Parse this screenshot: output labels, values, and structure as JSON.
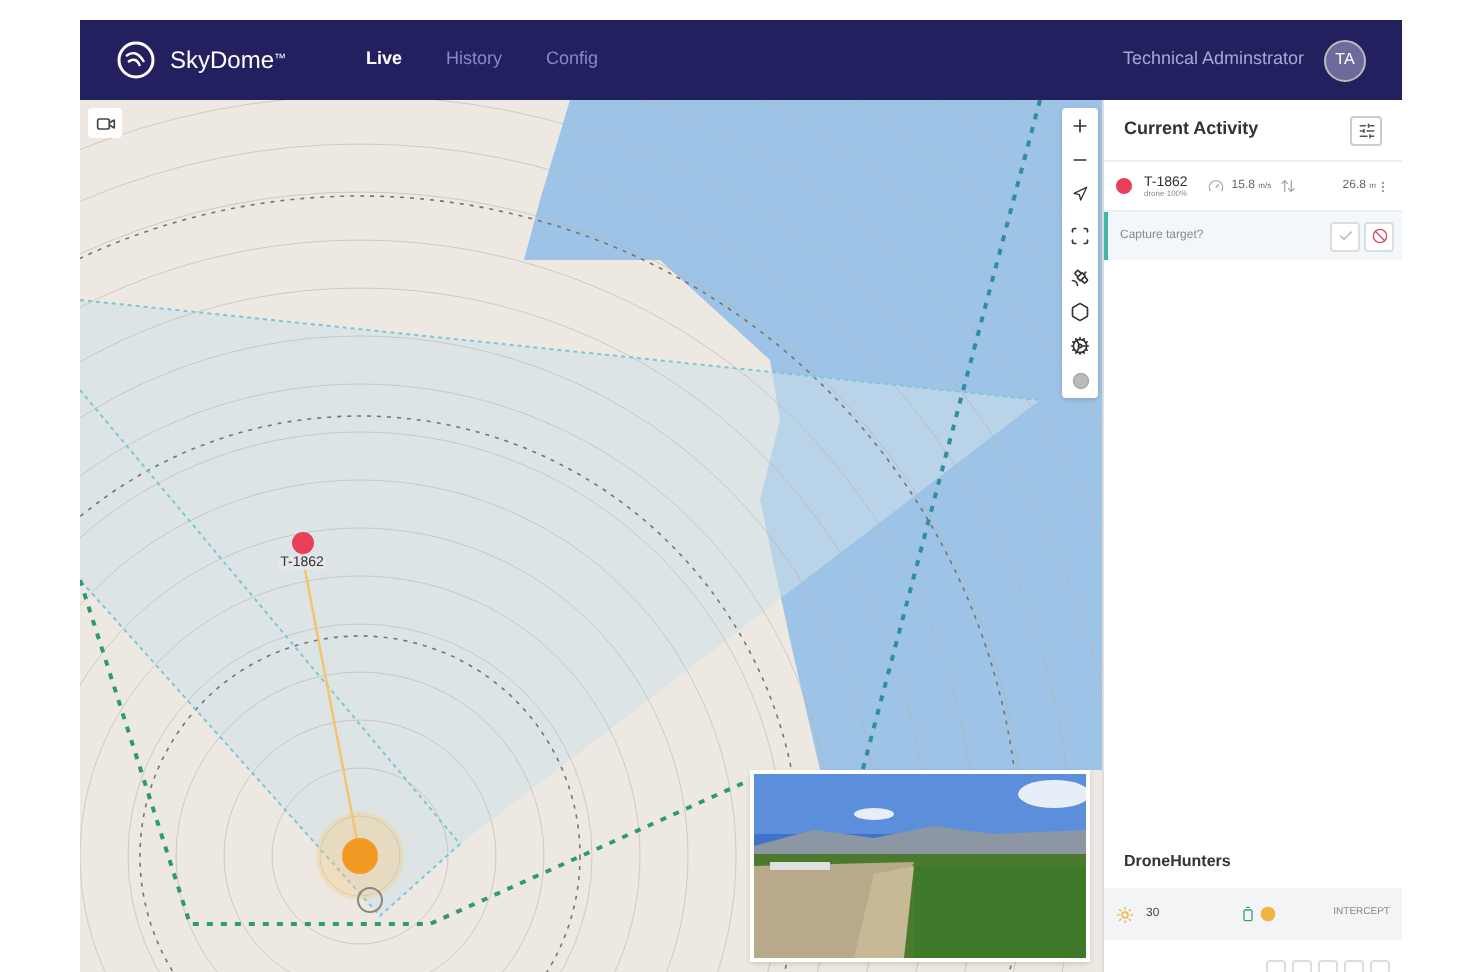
{
  "app": {
    "brand": "SkyDome",
    "brand_mark": "™"
  },
  "nav": [
    {
      "label": "Live",
      "selected": true
    },
    {
      "label": "History",
      "selected": false
    },
    {
      "label": "Config",
      "selected": false
    }
  ],
  "user": {
    "name": "Technical Adminstrator",
    "initials": "TA"
  },
  "map": {
    "targets": [
      {
        "label": "T-1862",
        "color": "#e8405a"
      }
    ]
  },
  "activity": {
    "title": "Current Activity",
    "items": [
      {
        "name": "T-1862",
        "sub": "drone 100%",
        "speed": "15.8",
        "speed_unit": "m/s",
        "altitude": "26.8",
        "altitude_unit": "m",
        "color": "#e8405a"
      }
    ],
    "prompt": "Capture target?"
  },
  "hunters": {
    "title": "DroneHunters",
    "items": [
      {
        "count": "30",
        "status": "INTERCEPT"
      }
    ]
  }
}
